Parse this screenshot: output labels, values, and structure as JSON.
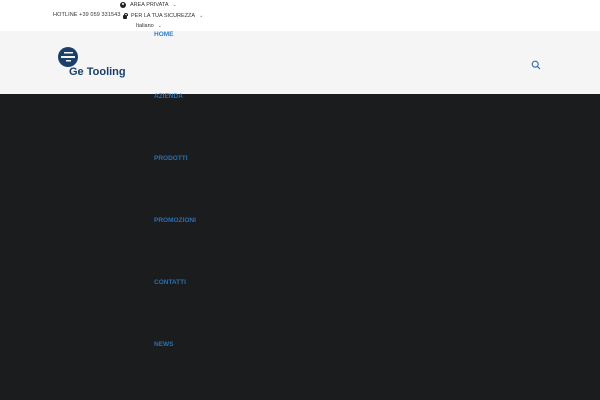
{
  "topbar": {
    "hotline": "HOTLINE +39 059 331543",
    "area_privata": "AREA PRIVATA",
    "sicurezza": "PER LA TUA SICUREZZA",
    "language": "Italiano",
    "caret": "⌄"
  },
  "header": {
    "logo_text": "Ge Tooling",
    "logo_color": "#1a3f6b"
  },
  "nav": {
    "items": [
      "HOME",
      "AZIENDA",
      "PRODOTTI",
      "PROMOZIONI",
      "CONTATTI",
      "NEWS"
    ],
    "active_color": "#2b7fd0",
    "item_color": "#2b6fb2"
  },
  "flag_colors": [
    "#1f9a3a",
    "#ffffff",
    "#d4242b"
  ]
}
